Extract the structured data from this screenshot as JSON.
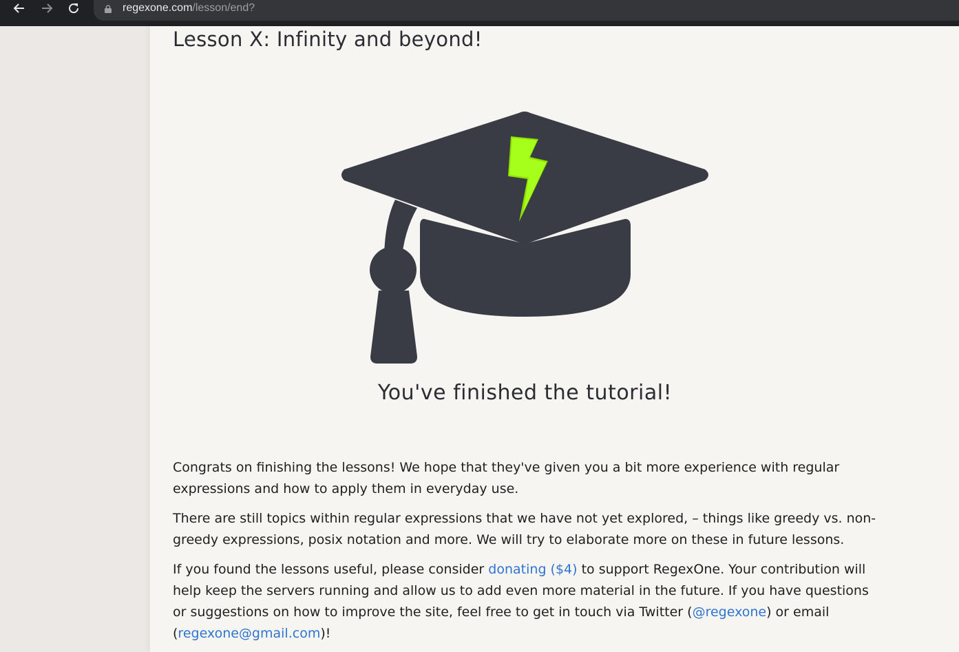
{
  "browser": {
    "url_host": "regexone.com",
    "url_path": "/lesson/end?"
  },
  "icons": {
    "back": "arrow-left-icon",
    "forward": "arrow-right-icon",
    "reload": "reload-icon",
    "lock": "lock-icon",
    "cap": "graduation-cap-icon"
  },
  "colors": {
    "cap_body": "#393c45",
    "bolt": "#8fe000",
    "link": "#2f74d0",
    "page_bg": "#f6f5f2"
  },
  "lesson": {
    "title": "Lesson X: Infinity and beyond!",
    "finished_heading": "You've finished the tutorial!",
    "paragraph1": "Congrats on finishing the lessons! We hope that they've given you a bit more experience with regular expressions and how to apply them in everyday use.",
    "paragraph2": "There are still topics within regular expressions that we have not yet explored, – things like greedy vs. non-greedy expressions, posix notation and more. We will try to elaborate more on these in future lessons.",
    "p3_part1": "If you found the lessons useful, please consider ",
    "p3_link_donate": "donating ($4)",
    "p3_part2": " to support RegexOne. Your contribution will help keep the servers running and allow us to add even more material in the future. If you have questions or suggestions on how to improve the site, feel free to get in touch via Twitter (",
    "p3_link_twitter": "@regexone",
    "p3_part3": ") or email (",
    "p3_link_email": "regexone@gmail.com",
    "p3_part4": ")!"
  }
}
